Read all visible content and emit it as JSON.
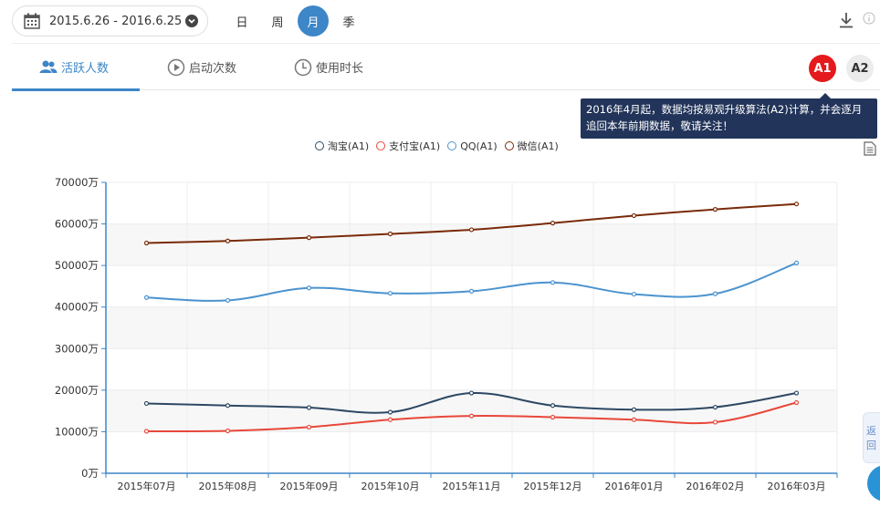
{
  "toolbar": {
    "date_range": "2015.6.26 - 2016.6.25",
    "periods": [
      "日",
      "周",
      "月",
      "季"
    ],
    "active_period": "月"
  },
  "tabs": [
    {
      "label": "活跃人数",
      "icon": "users-icon",
      "active": true
    },
    {
      "label": "启动次数",
      "icon": "play-icon",
      "active": false
    },
    {
      "label": "使用时长",
      "icon": "clock-icon",
      "active": false
    }
  ],
  "algorithm": {
    "a1": "A1",
    "a2": "A2"
  },
  "notice": {
    "line1": "2016年4月起，数据均按易观升级算法(A2)计算，并会逐月",
    "line2": "追回本年前期数据，敬请关注！"
  },
  "side": {
    "back_label": "返回"
  },
  "colors": {
    "accent": "#3d86c7",
    "a1_badge": "#e41a1c",
    "tooltip_bg": "#22345a"
  },
  "chart_data": {
    "type": "line",
    "categories": [
      "2015年07月",
      "2015年08月",
      "2015年09月",
      "2015年10月",
      "2015年11月",
      "2015年12月",
      "2016年01月",
      "2016年02月",
      "2016年03月"
    ],
    "y_tick_labels": [
      "0万",
      "10000万",
      "20000万",
      "30000万",
      "40000万",
      "50000万",
      "60000万",
      "70000万"
    ],
    "ylim": [
      0,
      70000
    ],
    "y_unit": "万",
    "grid": true,
    "legend_position": "top-center",
    "series": [
      {
        "name": "淘宝(A1)",
        "color": "#2d4863",
        "values": [
          16800,
          16300,
          15800,
          14700,
          19300,
          16300,
          15300,
          15900,
          19300
        ]
      },
      {
        "name": "支付宝(A1)",
        "color": "#e8483a",
        "values": [
          10100,
          10200,
          11100,
          12900,
          13800,
          13500,
          12900,
          12300,
          17000
        ]
      },
      {
        "name": "QQ(A1)",
        "color": "#4b93cf",
        "values": [
          42300,
          41600,
          44600,
          43300,
          43800,
          45900,
          43100,
          43200,
          50600
        ]
      },
      {
        "name": "微信(A1)",
        "color": "#7a2a08",
        "values": [
          55400,
          55900,
          56700,
          57600,
          58600,
          60200,
          62000,
          63500,
          64800
        ]
      }
    ]
  }
}
